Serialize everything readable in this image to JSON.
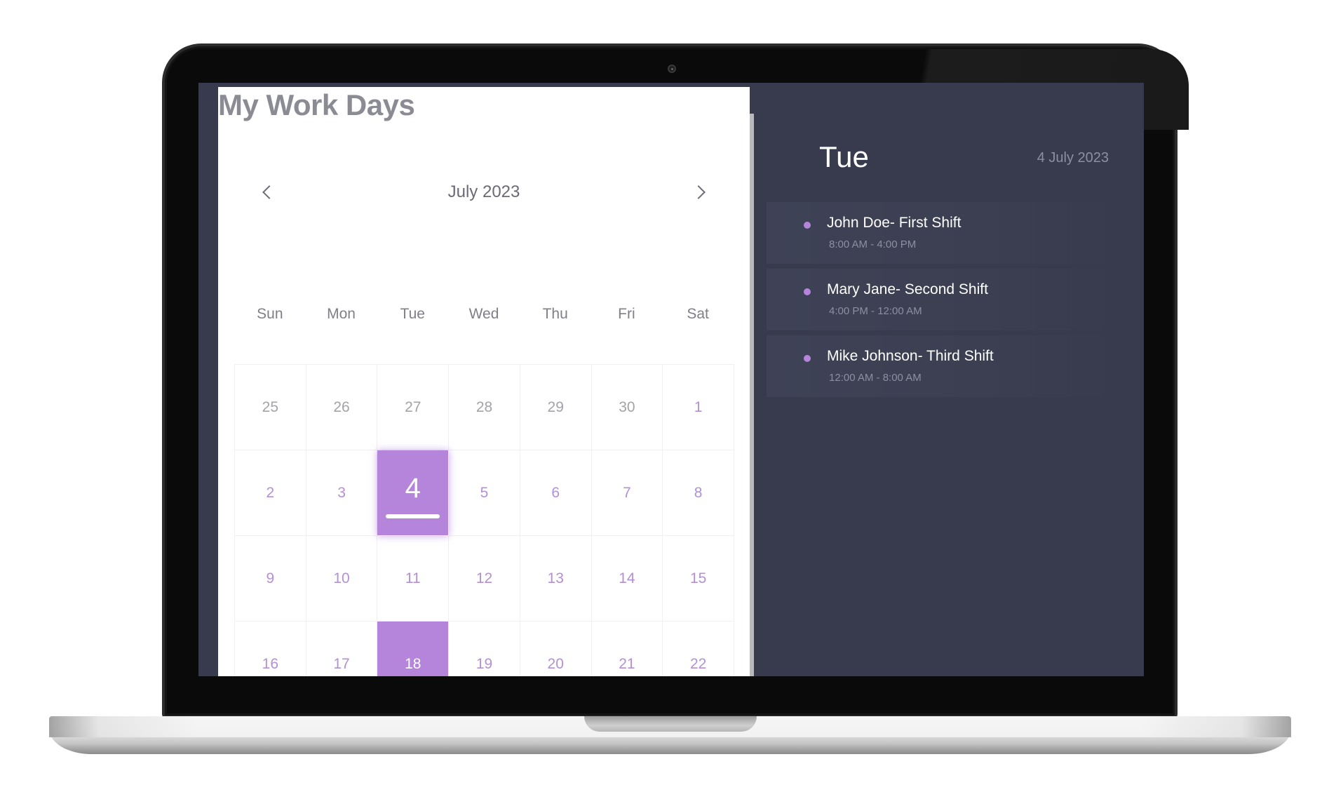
{
  "app": {
    "title": "My Work Days"
  },
  "calendar": {
    "month_label": "July 2023",
    "prev_icon": "chevron-left-icon",
    "next_icon": "chevron-right-icon",
    "weekdays": [
      "Sun",
      "Mon",
      "Tue",
      "Wed",
      "Thu",
      "Fri",
      "Sat"
    ],
    "weeks": [
      [
        {
          "day": "25",
          "state": "muted"
        },
        {
          "day": "26",
          "state": "muted"
        },
        {
          "day": "27",
          "state": "muted"
        },
        {
          "day": "28",
          "state": "muted"
        },
        {
          "day": "29",
          "state": "muted"
        },
        {
          "day": "30",
          "state": "muted"
        },
        {
          "day": "1",
          "state": "normal"
        }
      ],
      [
        {
          "day": "2",
          "state": "normal"
        },
        {
          "day": "3",
          "state": "normal"
        },
        {
          "day": "4",
          "state": "selected"
        },
        {
          "day": "5",
          "state": "normal"
        },
        {
          "day": "6",
          "state": "normal"
        },
        {
          "day": "7",
          "state": "normal"
        },
        {
          "day": "8",
          "state": "normal"
        }
      ],
      [
        {
          "day": "9",
          "state": "normal"
        },
        {
          "day": "10",
          "state": "normal"
        },
        {
          "day": "11",
          "state": "normal"
        },
        {
          "day": "12",
          "state": "normal"
        },
        {
          "day": "13",
          "state": "normal"
        },
        {
          "day": "14",
          "state": "normal"
        },
        {
          "day": "15",
          "state": "normal"
        }
      ],
      [
        {
          "day": "16",
          "state": "normal"
        },
        {
          "day": "17",
          "state": "normal"
        },
        {
          "day": "18",
          "state": "highlight"
        },
        {
          "day": "19",
          "state": "normal"
        },
        {
          "day": "20",
          "state": "normal"
        },
        {
          "day": "21",
          "state": "normal"
        },
        {
          "day": "22",
          "state": "normal"
        }
      ]
    ]
  },
  "schedule": {
    "day_label": "Tue",
    "date_label": "4 July 2023",
    "shifts": [
      {
        "name": "John Doe- First Shift",
        "time": "8:00 AM - 4:00 PM"
      },
      {
        "name": "Mary Jane- Second Shift",
        "time": "4:00 PM - 12:00 AM"
      },
      {
        "name": "Mike Johnson- Third Shift",
        "time": "12:00 AM - 8:00 AM"
      }
    ]
  },
  "colors": {
    "accent": "#b485db",
    "panel_bg": "#383b4d",
    "title_gray": "#8b8b94",
    "muted_day": "#a3a3aa"
  }
}
